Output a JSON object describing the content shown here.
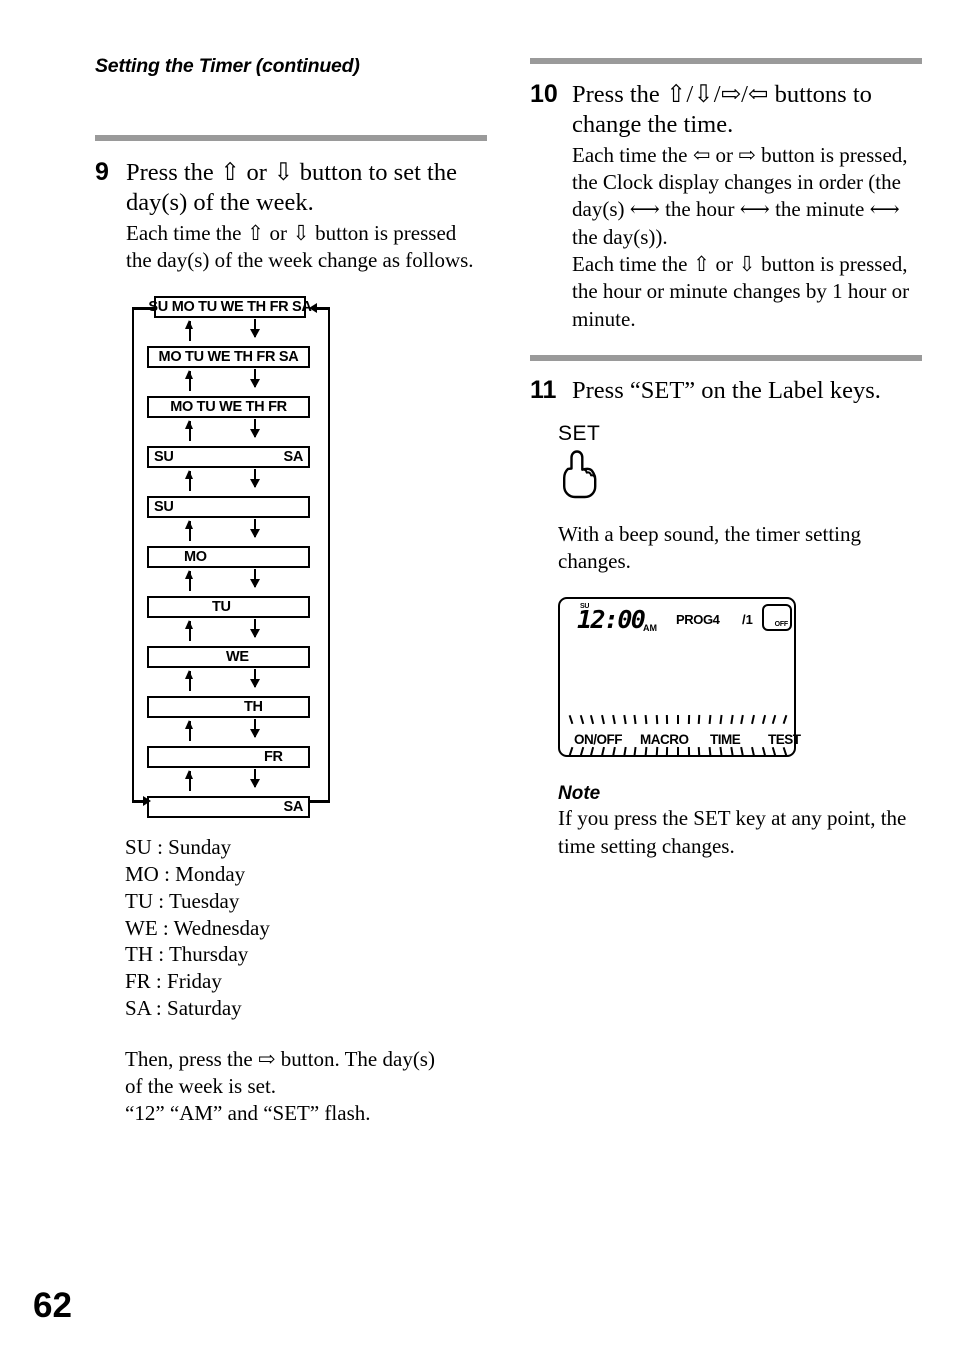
{
  "page": {
    "running_head": "Setting the Timer (continued)",
    "folio": "62",
    "rule_color": "#9a9a9a"
  },
  "steps": [
    {
      "number": "9",
      "title": "Press the ⇧ or ⇩ button to set the day(s) of the week.",
      "body": "Each time the ⇧ or ⇩ button is pressed the day(s) of the week change as follows."
    },
    {
      "number": "10",
      "title": "Press the ⇧/⇩/⇨/⇦ buttons to change the time.",
      "body1": "Each time the ⇦ or ⇨ button is pressed, the Clock display changes in order (the day(s) ⟷ the hour ⟷ the minute ⟷ the day(s)).",
      "body2": "Each time the ⇧ or ⇩ button is pressed, the hour or minute changes by 1 hour or minute."
    },
    {
      "number": "11",
      "title": "Press “SET” on the Label keys.",
      "key_label": "SET",
      "hand_icon": "pointing-hand-up-icon",
      "body": "With a beep sound, the timer setting changes."
    }
  ],
  "diagram": {
    "name": "day-of-week-cycle-diagram",
    "boxes": [
      {
        "text": "SU MO TU WE TH FR SA",
        "align": "center",
        "first": true
      },
      {
        "text": "MO TU WE TH FR SA",
        "align": "center"
      },
      {
        "text": "MO TU WE TH FR",
        "align": "center"
      },
      {
        "text_left": "SU",
        "text_right": "SA",
        "align": "split"
      },
      {
        "text": "SU",
        "align": "left"
      },
      {
        "text": "MO",
        "align": "p28"
      },
      {
        "text": "TU",
        "align": "p45"
      },
      {
        "text": "WE",
        "align": "p55"
      },
      {
        "text": "TH",
        "align": "p66"
      },
      {
        "text": "FR",
        "align": "p80"
      },
      {
        "text": "SA",
        "align": "right"
      }
    ]
  },
  "legend": {
    "title": "day-abbreviation-legend",
    "items": [
      "SU : Sunday",
      "MO : Monday",
      "TU : Tuesday",
      "WE : Wednesday",
      "TH : Thursday",
      "FR : Friday",
      "SA : Saturday"
    ]
  },
  "closing": {
    "line1": "Then, press the ⇨ button. The day(s)",
    "line2": "of the week is set.",
    "line3": "“12” “AM” and “SET” flash."
  },
  "lcd": {
    "name": "lcd-display-illustration",
    "day_indicator": "SU",
    "time": "12:00",
    "meridiem": "AM",
    "program": "PROG4",
    "page_indicator": "/1",
    "off_badge": "OFF",
    "label_keys": [
      "ON/OFF",
      "MACRO",
      "TIME",
      "TEST"
    ],
    "flash_ticks": 21
  },
  "note": {
    "heading": "Note",
    "body": "If you press the SET key at any point, the time setting changes."
  }
}
